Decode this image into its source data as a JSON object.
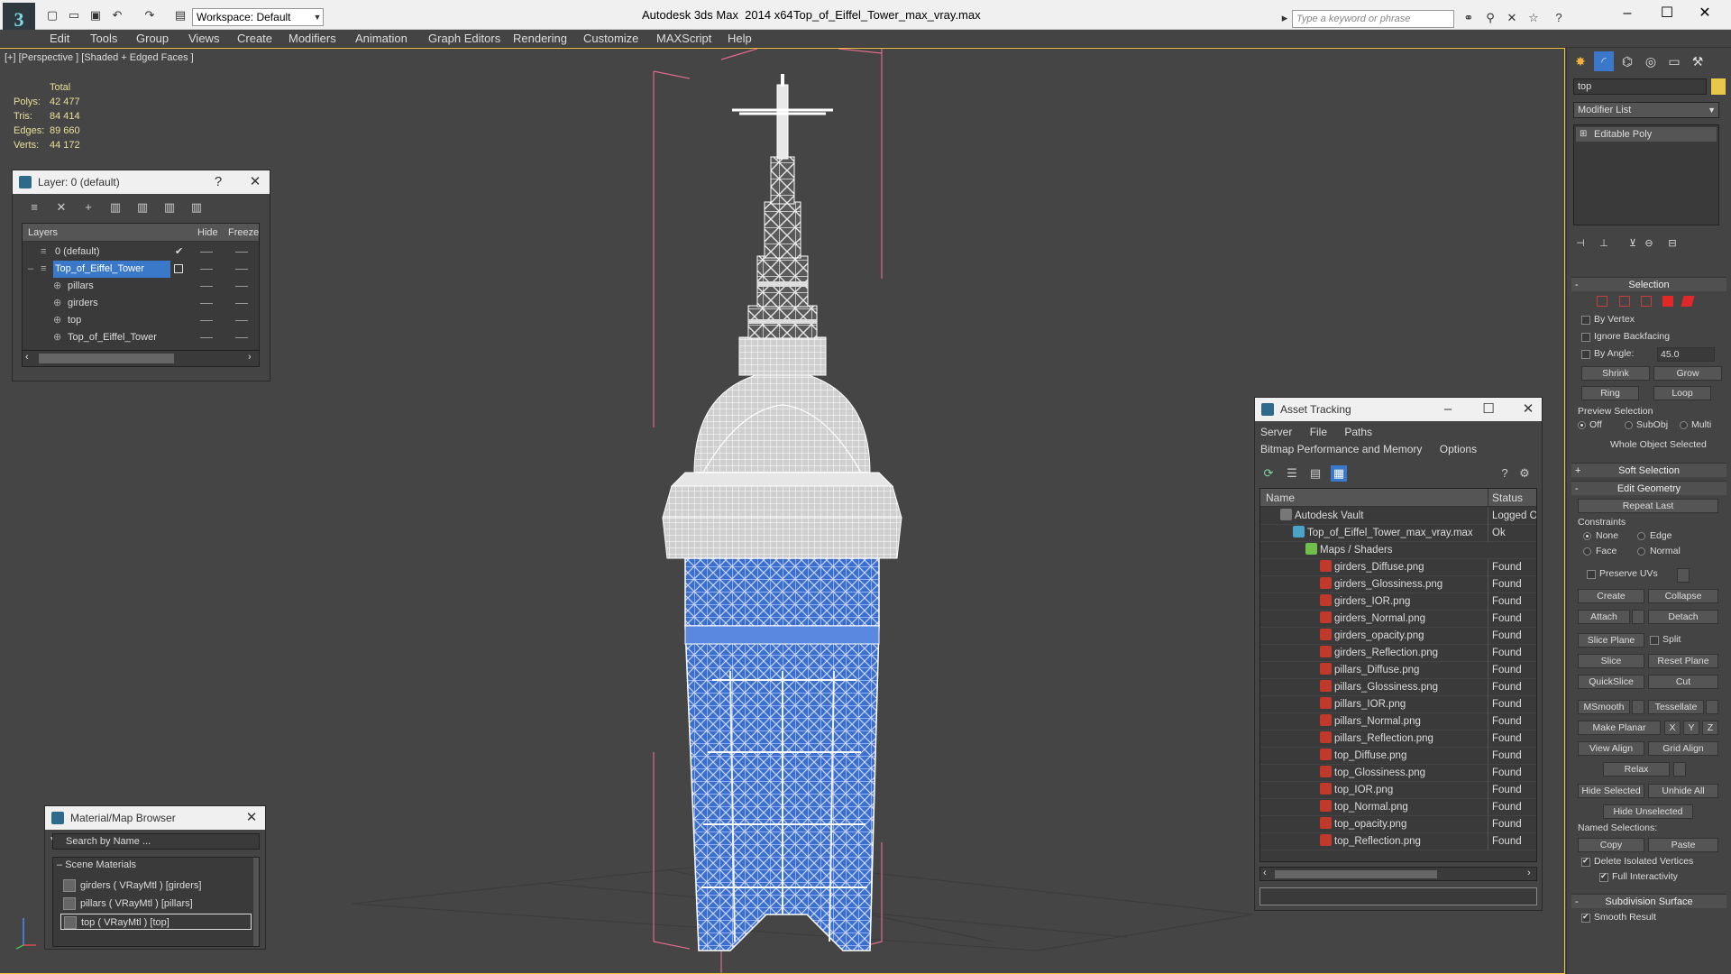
{
  "titlebar": {
    "workspace_label": "Workspace: Default",
    "app_title": "Autodesk 3ds Max  2014 x64",
    "file_title": "Top_of_Eiffel_Tower_max_vray.max",
    "search_placeholder": "Type a keyword or phrase"
  },
  "menu": [
    "Edit",
    "Tools",
    "Group",
    "Views",
    "Create",
    "Modifiers",
    "Animation",
    "Graph Editors",
    "Rendering",
    "Customize",
    "MAXScript",
    "Help"
  ],
  "viewport": {
    "label": "[+] [Perspective ] [Shaded + Edged Faces ]",
    "stats": {
      "total_label": "Total",
      "rows": [
        {
          "label": "Polys:",
          "value": "42 477"
        },
        {
          "label": "Tris:",
          "value": "84 414"
        },
        {
          "label": "Edges:",
          "value": "89 660"
        },
        {
          "label": "Verts:",
          "value": "44 172"
        }
      ]
    }
  },
  "layer_panel": {
    "title": "Layer: 0 (default)",
    "help": "?",
    "columns": {
      "layers": "Layers",
      "hide": "Hide",
      "freeze": "Freeze"
    },
    "rows": [
      {
        "name": "0 (default)",
        "indent": 0,
        "selected": false,
        "current": true
      },
      {
        "name": "Top_of_Eiffel_Tower",
        "indent": 0,
        "selected": true,
        "current": false
      },
      {
        "name": "pillars",
        "indent": 1,
        "selected": false,
        "current": false
      },
      {
        "name": "girders",
        "indent": 1,
        "selected": false,
        "current": false
      },
      {
        "name": "top",
        "indent": 1,
        "selected": false,
        "current": false
      },
      {
        "name": "Top_of_Eiffel_Tower",
        "indent": 1,
        "selected": false,
        "current": false
      }
    ]
  },
  "material_browser": {
    "title": "Material/Map Browser",
    "search_placeholder": "Search by Name ...",
    "group": "Scene Materials",
    "items": [
      "girders  ( VRayMtl ) [girders]",
      "pillars  ( VRayMtl ) [pillars]",
      "top  ( VRayMtl ) [top]"
    ]
  },
  "asset_tracking": {
    "title": "Asset Tracking",
    "menu1": [
      "Server",
      "File",
      "Paths"
    ],
    "menu2": [
      "Bitmap Performance and Memory",
      "Options"
    ],
    "columns": {
      "name": "Name",
      "status": "Status"
    },
    "rows": [
      {
        "name": "Autodesk Vault",
        "status": "Logged Ou",
        "level": 0,
        "kind": "vault"
      },
      {
        "name": "Top_of_Eiffel_Tower_max_vray.max",
        "status": "Ok",
        "level": 1,
        "kind": "max"
      },
      {
        "name": "Maps / Shaders",
        "status": "",
        "level": 2,
        "kind": "maps"
      },
      {
        "name": "girders_Diffuse.png",
        "status": "Found",
        "level": 3,
        "kind": "png"
      },
      {
        "name": "girders_Glossiness.png",
        "status": "Found",
        "level": 3,
        "kind": "png"
      },
      {
        "name": "girders_IOR.png",
        "status": "Found",
        "level": 3,
        "kind": "png"
      },
      {
        "name": "girders_Normal.png",
        "status": "Found",
        "level": 3,
        "kind": "png"
      },
      {
        "name": "girders_opacity.png",
        "status": "Found",
        "level": 3,
        "kind": "png"
      },
      {
        "name": "girders_Reflection.png",
        "status": "Found",
        "level": 3,
        "kind": "png"
      },
      {
        "name": "pillars_Diffuse.png",
        "status": "Found",
        "level": 3,
        "kind": "png"
      },
      {
        "name": "pillars_Glossiness.png",
        "status": "Found",
        "level": 3,
        "kind": "png"
      },
      {
        "name": "pillars_IOR.png",
        "status": "Found",
        "level": 3,
        "kind": "png"
      },
      {
        "name": "pillars_Normal.png",
        "status": "Found",
        "level": 3,
        "kind": "png"
      },
      {
        "name": "pillars_Reflection.png",
        "status": "Found",
        "level": 3,
        "kind": "png"
      },
      {
        "name": "top_Diffuse.png",
        "status": "Found",
        "level": 3,
        "kind": "png"
      },
      {
        "name": "top_Glossiness.png",
        "status": "Found",
        "level": 3,
        "kind": "png"
      },
      {
        "name": "top_IOR.png",
        "status": "Found",
        "level": 3,
        "kind": "png"
      },
      {
        "name": "top_Normal.png",
        "status": "Found",
        "level": 3,
        "kind": "png"
      },
      {
        "name": "top_opacity.png",
        "status": "Found",
        "level": 3,
        "kind": "png"
      },
      {
        "name": "top_Reflection.png",
        "status": "Found",
        "level": 3,
        "kind": "png"
      }
    ]
  },
  "command_panel": {
    "object_name": "top",
    "object_color": "#e8c84b",
    "modifier_list": "Modifier List",
    "stack_item": "Editable Poly",
    "selection": {
      "title": "Selection",
      "by_vertex": "By Vertex",
      "ignore_backfacing": "Ignore Backfacing",
      "by_angle": "By Angle:",
      "angle_value": "45.0",
      "shrink": "Shrink",
      "grow": "Grow",
      "ring": "Ring",
      "loop": "Loop",
      "preview_selection": "Preview Selection",
      "off": "Off",
      "subobj": "SubObj",
      "multi": "Multi",
      "whole_object": "Whole Object Selected"
    },
    "soft_selection": "Soft Selection",
    "edit_geometry": {
      "title": "Edit Geometry",
      "repeat_last": "Repeat Last",
      "constraints": "Constraints",
      "none": "None",
      "edge": "Edge",
      "face": "Face",
      "normal": "Normal",
      "preserve_uvs": "Preserve UVs",
      "create": "Create",
      "collapse": "Collapse",
      "attach": "Attach",
      "detach": "Detach",
      "slice_plane": "Slice Plane",
      "split": "Split",
      "slice": "Slice",
      "reset_plane": "Reset Plane",
      "quickslice": "QuickSlice",
      "cut": "Cut",
      "msmooth": "MSmooth",
      "tessellate": "Tessellate",
      "make_planar": "Make Planar",
      "x": "X",
      "y": "Y",
      "z": "Z",
      "view_align": "View Align",
      "grid_align": "Grid Align",
      "relax": "Relax",
      "hide_selected": "Hide Selected",
      "unhide_all": "Unhide All",
      "hide_unselected": "Hide Unselected",
      "named_selections": "Named Selections:",
      "copy": "Copy",
      "paste": "Paste",
      "delete_isolated": "Delete Isolated Vertices",
      "full_interactivity": "Full Interactivity"
    },
    "subdivision_surface": "Subdivision Surface",
    "smooth_result": "Smooth Result"
  },
  "colors": {
    "selection_blue": "#3a78c9",
    "tower_blue": "#3a6fd0",
    "wire_white": "#f2f2f2",
    "bbox_pink": "#e06a8a",
    "accent_yellow": "#f5c542"
  }
}
